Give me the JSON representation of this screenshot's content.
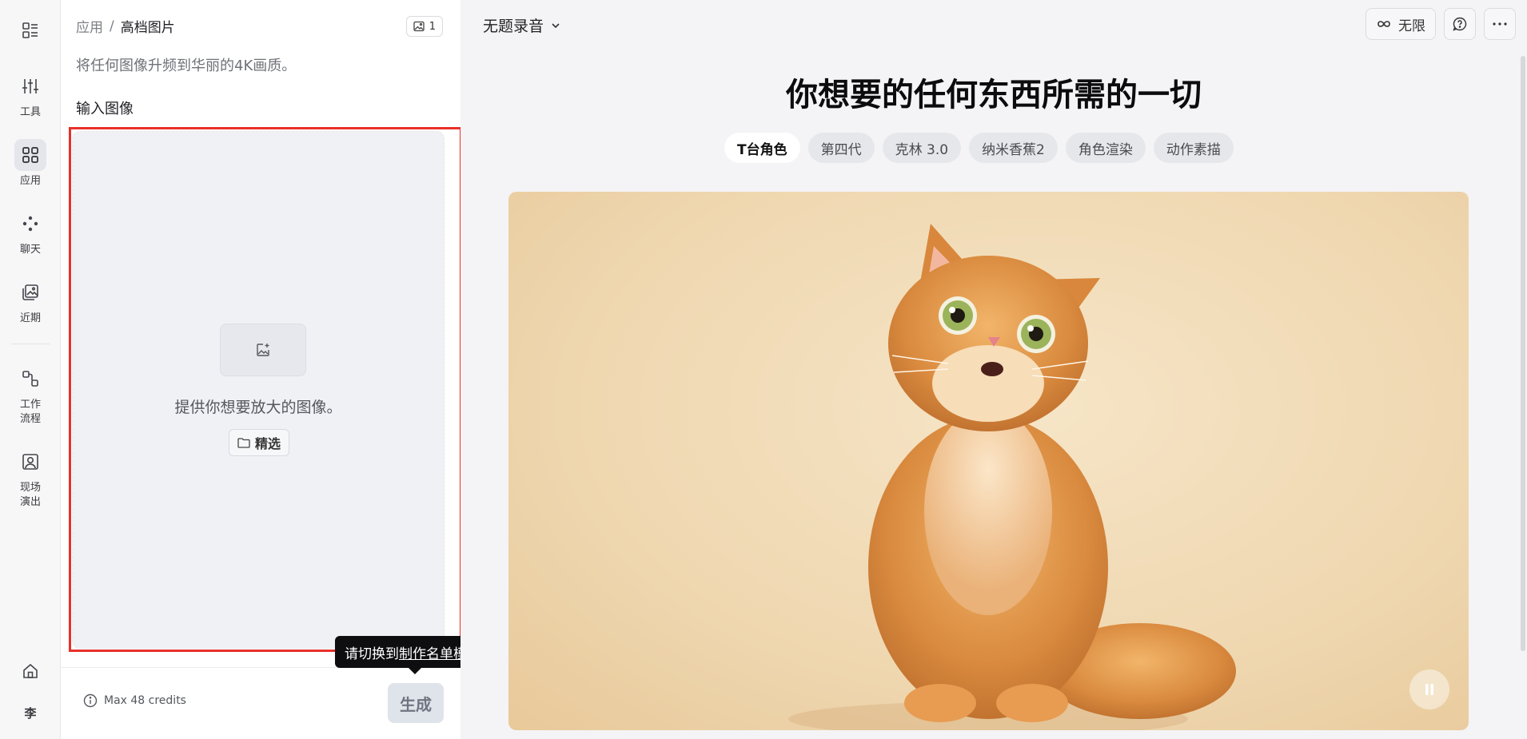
{
  "rail": {
    "items": [
      {
        "label": "工具",
        "icon": "sliders-icon"
      },
      {
        "label": "应用",
        "icon": "grid-icon"
      },
      {
        "label": "聊天",
        "icon": "nodes-icon"
      },
      {
        "label": "近期",
        "icon": "images-icon"
      },
      {
        "label": "工作\n流程",
        "icon": "workflow-icon"
      },
      {
        "label": "现场\n演出",
        "icon": "portrait-icon"
      }
    ],
    "avatar": "李"
  },
  "panel": {
    "breadcrumb_root": "应用",
    "breadcrumb_sep": "/",
    "breadcrumb_current": "高档图片",
    "image_count": "1",
    "description": "将任何图像升频到华丽的4K画质。",
    "section_title": "输入图像",
    "drop_text": "提供你想要放大的图像。",
    "browse_label": "精选",
    "credits": "Max 48 credits",
    "generate_label": "生成",
    "tooltip_prefix": "请切换到",
    "tooltip_link": "制作名单模式",
    "tooltip_suffix": "."
  },
  "main": {
    "doc_title": "无题录音",
    "unlimited_label": "无限",
    "hero_title": "你想要的任何东西所需的一切",
    "chips": [
      "T台角色",
      "第四代",
      "克林 3.0",
      "纳米香蕉2",
      "角色渲染",
      "动作素描"
    ]
  },
  "colors": {
    "highlight_frame": "#e8302a",
    "tooltip_bg": "#0e0e10",
    "generate_disabled": "#dfe3ea"
  }
}
